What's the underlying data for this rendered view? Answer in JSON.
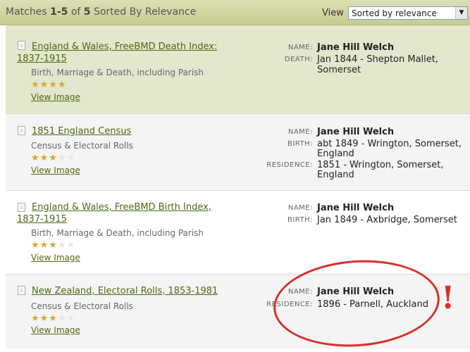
{
  "header": {
    "matches_prefix": "Matches ",
    "range": "1-5",
    "of_text": " of ",
    "total": "5",
    "sorted_text": " Sorted By Relevance",
    "view_label": "View",
    "sort_value": "Sorted by relevance"
  },
  "results": [
    {
      "title_line1": "England & Wales, FreeBMD Death Index:",
      "title_line2": "1837-1915",
      "category": "Birth, Marriage & Death, including Parish",
      "rating": 3.5,
      "view_image": "View Image",
      "fields": [
        {
          "label": "NAME:",
          "value": "Jane Hill Welch"
        },
        {
          "label": "DEATH:",
          "value_line1": "Jan 1844  - Shepton Mallet,",
          "value_line2": "Somerset"
        }
      ]
    },
    {
      "title_line1": "1851 England Census",
      "category": "Census & Electoral Rolls",
      "rating": 3,
      "view_image": "View Image",
      "fields": [
        {
          "label": "NAME:",
          "value": "Jane Hill Welch"
        },
        {
          "label": "BIRTH:",
          "value_line1": "abt 1849 - Wrington, Somerset,",
          "value_line2": "England"
        },
        {
          "label": "RESIDENCE:",
          "value_line1": "1851 - Wrington, Somerset,",
          "value_line2": "England"
        }
      ]
    },
    {
      "title_line1": "England & Wales, FreeBMD Birth Index,",
      "title_line2": "1837-1915",
      "category": "Birth, Marriage & Death, including Parish",
      "rating": 3,
      "view_image": "View Image",
      "fields": [
        {
          "label": "NAME:",
          "value": "Jane Hill Welch"
        },
        {
          "label": "BIRTH:",
          "value_line1": "Jan 1849  - Axbridge, Somerset"
        }
      ]
    },
    {
      "title_line1": "New Zealand, Electoral Rolls, 1853-1981",
      "category": "Census & Electoral Rolls",
      "rating": 3,
      "view_image": "View Image",
      "fields": [
        {
          "label": "NAME:",
          "value": "Jane Hill Welch"
        },
        {
          "label": "RESIDENCE:",
          "value_line1": "1896 - Parnell, Auckland"
        }
      ]
    }
  ],
  "annotation": {
    "exclamation": "!",
    "color": "#d6312c"
  },
  "colors": {
    "link": "#4a6a12",
    "star": "#d4a82c",
    "header_bg": "#d2d59e"
  }
}
